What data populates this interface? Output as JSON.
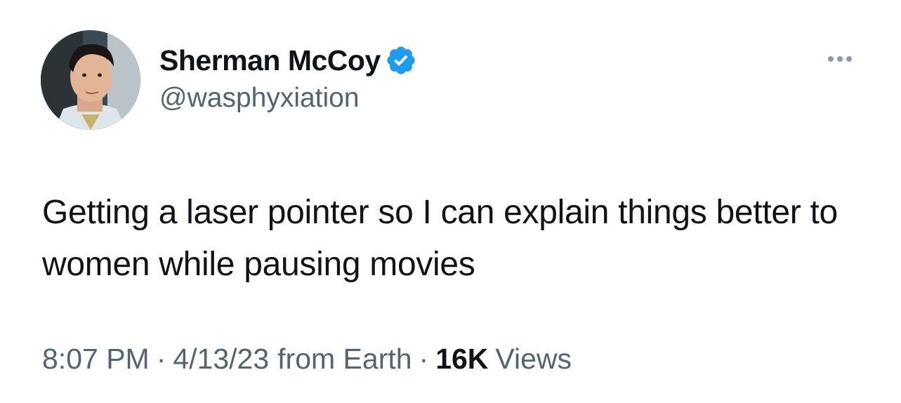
{
  "author": {
    "display_name": "Sherman McCoy",
    "handle": "@wasphyxiation",
    "verified": true,
    "verified_color": "#1d9bf0"
  },
  "tweet": {
    "text": "Getting a laser pointer so I can explain things better to women while pausing movies"
  },
  "meta": {
    "time": "8:07 PM",
    "date": "4/13/23",
    "source": "from Earth",
    "separator": "·",
    "views_count": "16K",
    "views_label": "Views"
  },
  "icons": {
    "more": "more-horizontal-icon",
    "verified": "verified-badge-icon",
    "avatar": "profile-photo"
  }
}
